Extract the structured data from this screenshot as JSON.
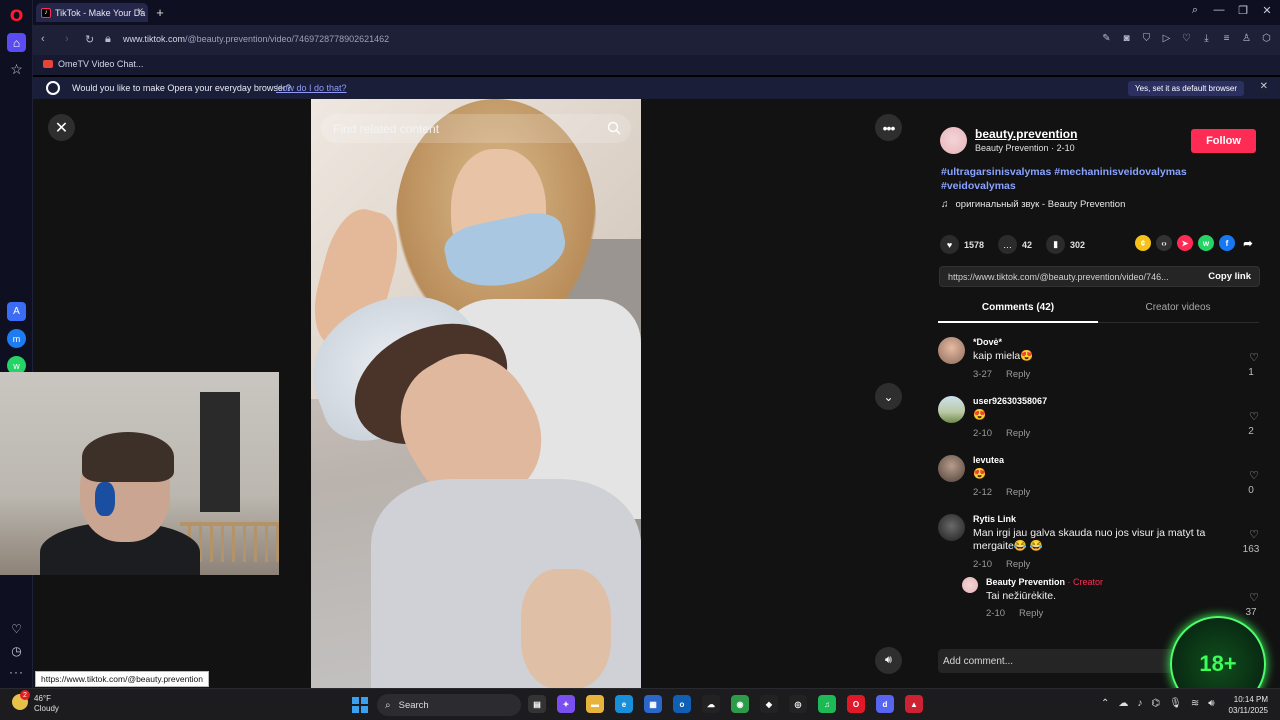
{
  "browser": {
    "tab_title": "TikTok - Make Your Da",
    "url_host": "www.tiktok.com",
    "url_path": "/@beauty.prevention/video/7469728778902621462",
    "bookmark": "OmeTV Video Chat...",
    "banner_text": "Would you like to make Opera your everyday browser?",
    "banner_link": "How do I do that?",
    "banner_button": "Yes, set it as default browser",
    "status_url": "https://www.tiktok.com/@beauty.prevention"
  },
  "video": {
    "search_placeholder": "Find related content"
  },
  "post": {
    "username": "beauty.prevention",
    "display_name": "Beauty Prevention",
    "date": "2-10",
    "hashtags": "#ultragarsinisvalymas #mechaninisveidovalymas #veidovalymas",
    "sound": "оригинальный звук - Beauty Prevention",
    "follow_label": "Follow",
    "likes": "1578",
    "comments_count": "42",
    "saves": "302",
    "share_link": "https://www.tiktok.com/@beauty.prevention/video/746...",
    "copy_link_label": "Copy link",
    "tab_comments": "Comments (42)",
    "tab_creator": "Creator videos",
    "add_comment_placeholder": "Add comment...",
    "badge": "18+"
  },
  "comments": [
    {
      "name": "*Dovė*",
      "text": "kaip miela😍",
      "date": "3-27",
      "reply": "Reply",
      "likes": "1"
    },
    {
      "name": "user92630358067",
      "text": "😍",
      "date": "2-10",
      "reply": "Reply",
      "likes": "2"
    },
    {
      "name": "Ievutea",
      "text": "😍",
      "date": "2-12",
      "reply": "Reply",
      "likes": "0"
    },
    {
      "name": "Rytis Link",
      "text": "Man irgi jau galva skauda nuo jos visur ja matyt ta mergaite😂 😂",
      "date": "2-10",
      "reply": "Reply",
      "likes": "163"
    },
    {
      "name": "Beauty Prevention",
      "creator_tag": "· Creator",
      "text": "Tai nežiūrėkite.",
      "date": "2-10",
      "reply": "Reply",
      "likes": "37"
    }
  ],
  "taskbar": {
    "weather_temp": "46°F",
    "weather_desc": "Cloudy",
    "weather_alert": "2",
    "search_label": "Search",
    "time": "10:14 PM",
    "date": "03/11/2025"
  },
  "colors": {
    "accent": "#fe2c55",
    "link": "#8aa3ff",
    "opera": "#ff1b2d"
  }
}
